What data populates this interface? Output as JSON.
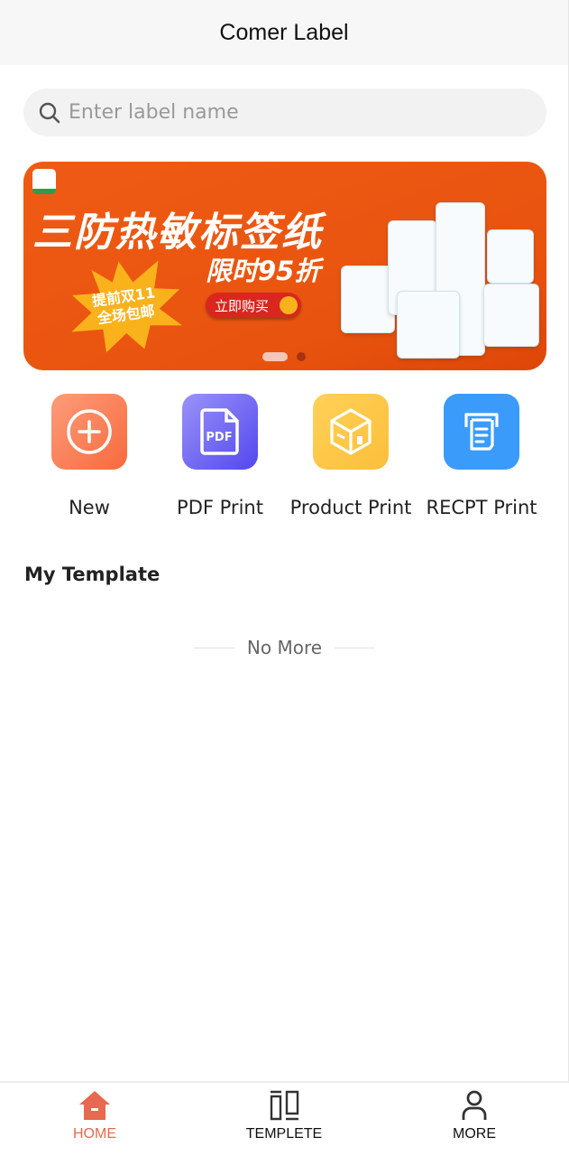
{
  "header": {
    "title": "Comer Label"
  },
  "search": {
    "placeholder": "Enter label name",
    "value": "",
    "icon": "search-icon"
  },
  "banner": {
    "headline": "三防热敏标签纸",
    "discount": "限时95折",
    "burst_line1": "提前双11",
    "burst_line2": "全场包邮",
    "buy_button": "立即购买",
    "active_slide": 1,
    "slide_count": 2
  },
  "actions": [
    {
      "label": "New",
      "icon": "plus-circle-icon",
      "color": "#f97a4f"
    },
    {
      "label": "PDF Print",
      "icon": "pdf-file-icon",
      "color": "#6d63f0"
    },
    {
      "label": "Product Print",
      "icon": "box-icon",
      "color": "#fdc543"
    },
    {
      "label": "RECPT Print",
      "icon": "receipt-printer-icon",
      "color": "#3a9bfb"
    }
  ],
  "my_template": {
    "title": "My Template",
    "empty_text": "No More"
  },
  "tabbar": {
    "active": "HOME",
    "active_color": "#e7694f",
    "items": [
      {
        "label": "HOME",
        "icon": "home-icon"
      },
      {
        "label": "TEMPLETE",
        "icon": "template-icon"
      },
      {
        "label": "MORE",
        "icon": "user-icon"
      }
    ]
  }
}
